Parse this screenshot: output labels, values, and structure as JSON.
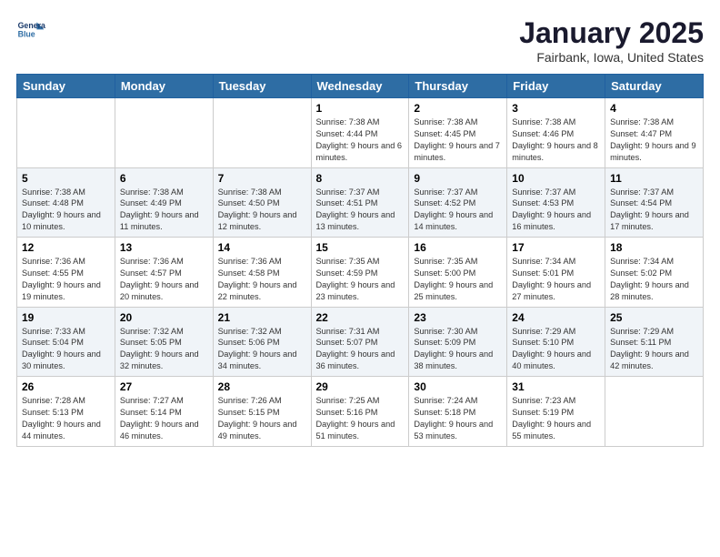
{
  "header": {
    "logo_line1": "General",
    "logo_line2": "Blue",
    "month": "January 2025",
    "location": "Fairbank, Iowa, United States"
  },
  "weekdays": [
    "Sunday",
    "Monday",
    "Tuesday",
    "Wednesday",
    "Thursday",
    "Friday",
    "Saturday"
  ],
  "weeks": [
    [
      {
        "day": "",
        "sunrise": "",
        "sunset": "",
        "daylight": ""
      },
      {
        "day": "",
        "sunrise": "",
        "sunset": "",
        "daylight": ""
      },
      {
        "day": "",
        "sunrise": "",
        "sunset": "",
        "daylight": ""
      },
      {
        "day": "1",
        "sunrise": "Sunrise: 7:38 AM",
        "sunset": "Sunset: 4:44 PM",
        "daylight": "Daylight: 9 hours and 6 minutes."
      },
      {
        "day": "2",
        "sunrise": "Sunrise: 7:38 AM",
        "sunset": "Sunset: 4:45 PM",
        "daylight": "Daylight: 9 hours and 7 minutes."
      },
      {
        "day": "3",
        "sunrise": "Sunrise: 7:38 AM",
        "sunset": "Sunset: 4:46 PM",
        "daylight": "Daylight: 9 hours and 8 minutes."
      },
      {
        "day": "4",
        "sunrise": "Sunrise: 7:38 AM",
        "sunset": "Sunset: 4:47 PM",
        "daylight": "Daylight: 9 hours and 9 minutes."
      }
    ],
    [
      {
        "day": "5",
        "sunrise": "Sunrise: 7:38 AM",
        "sunset": "Sunset: 4:48 PM",
        "daylight": "Daylight: 9 hours and 10 minutes."
      },
      {
        "day": "6",
        "sunrise": "Sunrise: 7:38 AM",
        "sunset": "Sunset: 4:49 PM",
        "daylight": "Daylight: 9 hours and 11 minutes."
      },
      {
        "day": "7",
        "sunrise": "Sunrise: 7:38 AM",
        "sunset": "Sunset: 4:50 PM",
        "daylight": "Daylight: 9 hours and 12 minutes."
      },
      {
        "day": "8",
        "sunrise": "Sunrise: 7:37 AM",
        "sunset": "Sunset: 4:51 PM",
        "daylight": "Daylight: 9 hours and 13 minutes."
      },
      {
        "day": "9",
        "sunrise": "Sunrise: 7:37 AM",
        "sunset": "Sunset: 4:52 PM",
        "daylight": "Daylight: 9 hours and 14 minutes."
      },
      {
        "day": "10",
        "sunrise": "Sunrise: 7:37 AM",
        "sunset": "Sunset: 4:53 PM",
        "daylight": "Daylight: 9 hours and 16 minutes."
      },
      {
        "day": "11",
        "sunrise": "Sunrise: 7:37 AM",
        "sunset": "Sunset: 4:54 PM",
        "daylight": "Daylight: 9 hours and 17 minutes."
      }
    ],
    [
      {
        "day": "12",
        "sunrise": "Sunrise: 7:36 AM",
        "sunset": "Sunset: 4:55 PM",
        "daylight": "Daylight: 9 hours and 19 minutes."
      },
      {
        "day": "13",
        "sunrise": "Sunrise: 7:36 AM",
        "sunset": "Sunset: 4:57 PM",
        "daylight": "Daylight: 9 hours and 20 minutes."
      },
      {
        "day": "14",
        "sunrise": "Sunrise: 7:36 AM",
        "sunset": "Sunset: 4:58 PM",
        "daylight": "Daylight: 9 hours and 22 minutes."
      },
      {
        "day": "15",
        "sunrise": "Sunrise: 7:35 AM",
        "sunset": "Sunset: 4:59 PM",
        "daylight": "Daylight: 9 hours and 23 minutes."
      },
      {
        "day": "16",
        "sunrise": "Sunrise: 7:35 AM",
        "sunset": "Sunset: 5:00 PM",
        "daylight": "Daylight: 9 hours and 25 minutes."
      },
      {
        "day": "17",
        "sunrise": "Sunrise: 7:34 AM",
        "sunset": "Sunset: 5:01 PM",
        "daylight": "Daylight: 9 hours and 27 minutes."
      },
      {
        "day": "18",
        "sunrise": "Sunrise: 7:34 AM",
        "sunset": "Sunset: 5:02 PM",
        "daylight": "Daylight: 9 hours and 28 minutes."
      }
    ],
    [
      {
        "day": "19",
        "sunrise": "Sunrise: 7:33 AM",
        "sunset": "Sunset: 5:04 PM",
        "daylight": "Daylight: 9 hours and 30 minutes."
      },
      {
        "day": "20",
        "sunrise": "Sunrise: 7:32 AM",
        "sunset": "Sunset: 5:05 PM",
        "daylight": "Daylight: 9 hours and 32 minutes."
      },
      {
        "day": "21",
        "sunrise": "Sunrise: 7:32 AM",
        "sunset": "Sunset: 5:06 PM",
        "daylight": "Daylight: 9 hours and 34 minutes."
      },
      {
        "day": "22",
        "sunrise": "Sunrise: 7:31 AM",
        "sunset": "Sunset: 5:07 PM",
        "daylight": "Daylight: 9 hours and 36 minutes."
      },
      {
        "day": "23",
        "sunrise": "Sunrise: 7:30 AM",
        "sunset": "Sunset: 5:09 PM",
        "daylight": "Daylight: 9 hours and 38 minutes."
      },
      {
        "day": "24",
        "sunrise": "Sunrise: 7:29 AM",
        "sunset": "Sunset: 5:10 PM",
        "daylight": "Daylight: 9 hours and 40 minutes."
      },
      {
        "day": "25",
        "sunrise": "Sunrise: 7:29 AM",
        "sunset": "Sunset: 5:11 PM",
        "daylight": "Daylight: 9 hours and 42 minutes."
      }
    ],
    [
      {
        "day": "26",
        "sunrise": "Sunrise: 7:28 AM",
        "sunset": "Sunset: 5:13 PM",
        "daylight": "Daylight: 9 hours and 44 minutes."
      },
      {
        "day": "27",
        "sunrise": "Sunrise: 7:27 AM",
        "sunset": "Sunset: 5:14 PM",
        "daylight": "Daylight: 9 hours and 46 minutes."
      },
      {
        "day": "28",
        "sunrise": "Sunrise: 7:26 AM",
        "sunset": "Sunset: 5:15 PM",
        "daylight": "Daylight: 9 hours and 49 minutes."
      },
      {
        "day": "29",
        "sunrise": "Sunrise: 7:25 AM",
        "sunset": "Sunset: 5:16 PM",
        "daylight": "Daylight: 9 hours and 51 minutes."
      },
      {
        "day": "30",
        "sunrise": "Sunrise: 7:24 AM",
        "sunset": "Sunset: 5:18 PM",
        "daylight": "Daylight: 9 hours and 53 minutes."
      },
      {
        "day": "31",
        "sunrise": "Sunrise: 7:23 AM",
        "sunset": "Sunset: 5:19 PM",
        "daylight": "Daylight: 9 hours and 55 minutes."
      },
      {
        "day": "",
        "sunrise": "",
        "sunset": "",
        "daylight": ""
      }
    ]
  ]
}
